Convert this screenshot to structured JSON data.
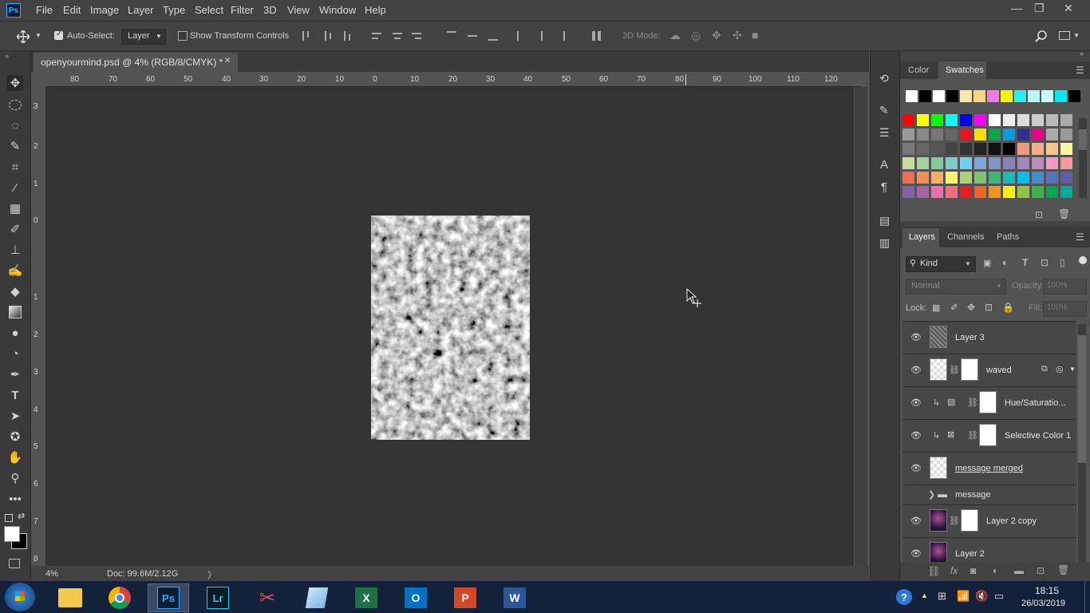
{
  "app": {
    "logo": "Ps",
    "window_controls": [
      "—",
      "❐",
      "✕"
    ]
  },
  "menu": [
    "File",
    "Edit",
    "Image",
    "Layer",
    "Type",
    "Select",
    "Filter",
    "3D",
    "View",
    "Window",
    "Help"
  ],
  "options": {
    "auto_select_label": "Auto-Select:",
    "auto_select_checked": true,
    "auto_select_target": "Layer",
    "show_transform_label": "Show Transform Controls",
    "mode_label": "3D Mode:"
  },
  "document": {
    "tab_title": "openyourmind.psd @ 4% (RGB/8/CMYK) *",
    "close_glyph": "✕",
    "ruler_h": [
      "80",
      "70",
      "60",
      "50",
      "40",
      "30",
      "20",
      "10",
      "0",
      "10",
      "20",
      "30",
      "40",
      "50",
      "60",
      "70",
      "80",
      "90",
      "100",
      "110",
      "120"
    ],
    "ruler_v": [
      "3",
      "2",
      "1",
      "0",
      "1",
      "2",
      "3",
      "4",
      "5",
      "6",
      "7",
      "8"
    ]
  },
  "status": {
    "zoom": "4%",
    "doc_info": "Doc: 99.6M/2.12G",
    "arrow": "〉"
  },
  "color_panel": {
    "tabs": [
      "Color",
      "Swatches"
    ],
    "active_tab": "Swatches",
    "swatch_top": [
      "#ffffff",
      "#000000",
      "#ffffff",
      "#000000",
      "#fde6a8",
      "#f9d77e",
      "#f178e8",
      "#f5f500",
      "#28f0f0",
      "#b8f8f8",
      "#c8ffff",
      "#00e8f0",
      "#000000"
    ],
    "swatch_rows": [
      [
        "#ff0000",
        "#ffff00",
        "#00ff00",
        "#00ffff",
        "#0000ff",
        "#ff00ff",
        "#ffffff",
        "#eeeeee",
        "#dddddd",
        "#cccccc",
        "#bbbbbb",
        "#aaaaaa"
      ],
      [
        "#999999",
        "#888888",
        "#777777",
        "#666666",
        "#ee1122",
        "#f5e100",
        "#00a650",
        "#00a0e0",
        "#2e3192",
        "#ec008c",
        "#aaaaaa",
        "#999999"
      ],
      [
        "#777777",
        "#666666",
        "#555555",
        "#444444",
        "#333333",
        "#222222",
        "#111111",
        "#000000",
        "#f4987a",
        "#f9ad81",
        "#fdc689",
        "#fff799"
      ],
      [
        "#c4df9b",
        "#a3d39c",
        "#82ca9c",
        "#7accc8",
        "#6dcff6",
        "#7da7d9",
        "#8393ca",
        "#8781bd",
        "#a187be",
        "#bd8cbf",
        "#f49ac1",
        "#f5989d"
      ],
      [
        "#f26c4f",
        "#f68e56",
        "#fbaf5d",
        "#fff568",
        "#acd373",
        "#7cc576",
        "#3bb878",
        "#1abbb4",
        "#00bff3",
        "#438ccb",
        "#5574b9",
        "#605ca8"
      ],
      [
        "#8560a8",
        "#a863a8",
        "#f06ea9",
        "#f26d7d",
        "#ed1c24",
        "#f26522",
        "#f7941d",
        "#fff200",
        "#8dc63f",
        "#39b54a",
        "#00a651",
        "#00a99d"
      ]
    ]
  },
  "layers_panel": {
    "tabs": [
      "Layers",
      "Channels",
      "Paths"
    ],
    "active_tab": "Layers",
    "filter_label": "Kind",
    "blend_mode": "Normal",
    "opacity_label": "Opacity:",
    "opacity_value": "100%",
    "lock_label": "Lock:",
    "fill_label": "Fill:",
    "fill_value": "100%",
    "layers": [
      {
        "name": "Layer 3",
        "visible": true
      },
      {
        "name": "waved",
        "visible": true
      },
      {
        "name": "Hue/Saturatio...",
        "visible": true
      },
      {
        "name": "Selective Color 1",
        "visible": true
      },
      {
        "name": "message merged",
        "visible": true
      },
      {
        "name": "message",
        "visible": false
      },
      {
        "name": "Layer 2 copy",
        "visible": true
      },
      {
        "name": "Layer 2",
        "visible": true
      }
    ]
  },
  "taskbar": {
    "apps": [
      "Windows Explorer",
      "Google Chrome",
      "Adobe Photoshop",
      "Adobe Lightroom",
      "Snipping Tool",
      "Notepad",
      "Microsoft Excel",
      "Microsoft Outlook",
      "Microsoft PowerPoint",
      "Microsoft Word"
    ],
    "active_app": "Adobe Photoshop",
    "time": "18:15",
    "date": "26/03/2019"
  }
}
